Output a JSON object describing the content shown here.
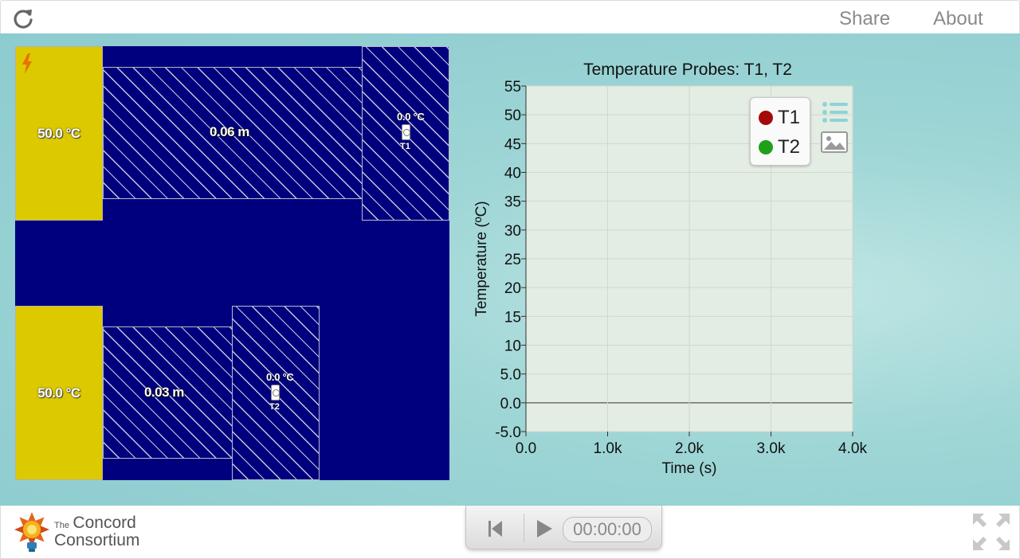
{
  "header": {
    "share_label": "Share",
    "about_label": "About"
  },
  "simulation": {
    "heaters": [
      {
        "temperature": "50.0 °C"
      },
      {
        "temperature": "50.0 °C"
      }
    ],
    "blocks": [
      {
        "length": "0.06 m"
      },
      {
        "length": "0.03 m"
      }
    ],
    "probes": [
      {
        "name": "T1",
        "value": "0.0 °C"
      },
      {
        "name": "T2",
        "value": "0.0 °C"
      }
    ]
  },
  "legend": [
    {
      "name": "T1",
      "color": "#a50a0a"
    },
    {
      "name": "T2",
      "color": "#1fa01a"
    }
  ],
  "chart_data": {
    "type": "line",
    "title": "Temperature Probes: T1, T2",
    "xlabel": "Time (s)",
    "ylabel": "Temperature (ºC)",
    "xlim": [
      0,
      4000
    ],
    "ylim": [
      -5,
      55
    ],
    "xticks": [
      0,
      1000,
      2000,
      3000,
      4000
    ],
    "xtick_labels": [
      "0.0",
      "1.0k",
      "2.0k",
      "3.0k",
      "4.0k"
    ],
    "yticks": [
      -5,
      0,
      5,
      10,
      15,
      20,
      25,
      30,
      35,
      40,
      45,
      50,
      55
    ],
    "ytick_labels": [
      "-5.0",
      "0.0",
      "5.0",
      "10",
      "15",
      "20",
      "25",
      "30",
      "35",
      "40",
      "45",
      "50",
      "55"
    ],
    "grid": true,
    "series": [
      {
        "name": "T1",
        "color": "#a50a0a",
        "points": []
      },
      {
        "name": "T2",
        "color": "#1fa01a",
        "points": []
      }
    ]
  },
  "footer": {
    "logo_the": "The",
    "logo_line1": "Concord",
    "logo_line2": "Consortium",
    "timer": "00:00:00"
  }
}
